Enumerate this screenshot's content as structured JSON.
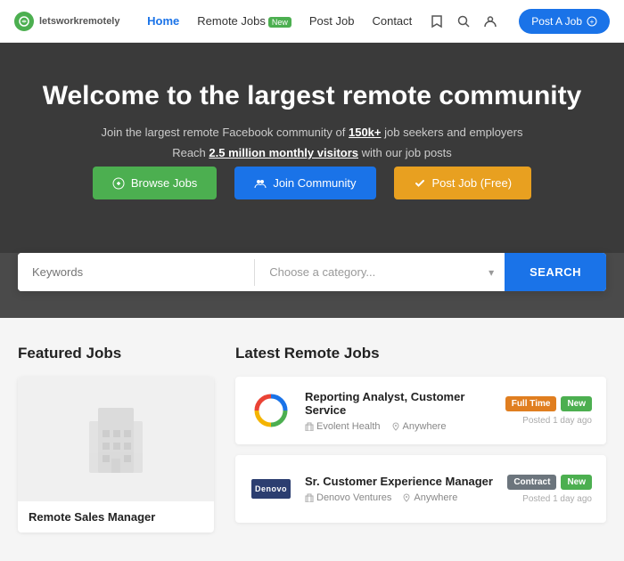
{
  "nav": {
    "logo_text": "letsworkremotely",
    "links": [
      {
        "label": "Home",
        "active": true
      },
      {
        "label": "Remote Jobs",
        "badge": "New"
      },
      {
        "label": "Post Job"
      },
      {
        "label": "Contact"
      }
    ],
    "post_job_btn": "Post A Job"
  },
  "hero": {
    "title": "Welcome to the largest remote community",
    "subtitle": "Join the largest remote Facebook community of",
    "subtitle_link": "150k+",
    "subtitle_end": "job seekers and employers",
    "sub2_prefix": "Reach",
    "sub2_link": "2.5 million monthly visitors",
    "sub2_end": "with our job posts",
    "btn_browse": "Browse Jobs",
    "btn_join": "Join Community",
    "btn_post": "Post Job (Free)"
  },
  "search": {
    "keywords_placeholder": "Keywords",
    "category_placeholder": "Choose a category...",
    "search_btn": "SEARCH"
  },
  "featured": {
    "section_title": "Featured Jobs",
    "job_title": "Remote Sales Manager"
  },
  "latest": {
    "section_title": "Latest Remote Jobs",
    "jobs": [
      {
        "id": 1,
        "title": "Reporting Analyst, Customer Service",
        "company": "Evolent Health",
        "location": "Anywhere",
        "tag1": "Full Time",
        "tag2": "New",
        "tag1_class": "tag-fulltime",
        "posted": "Posted 1 day ago"
      },
      {
        "id": 2,
        "title": "Sr. Customer Experience Manager",
        "company": "Denovo Ventures",
        "location": "Anywhere",
        "tag1": "Contract",
        "tag2": "New",
        "tag1_class": "tag-contract",
        "posted": "Posted 1 day ago"
      }
    ]
  }
}
